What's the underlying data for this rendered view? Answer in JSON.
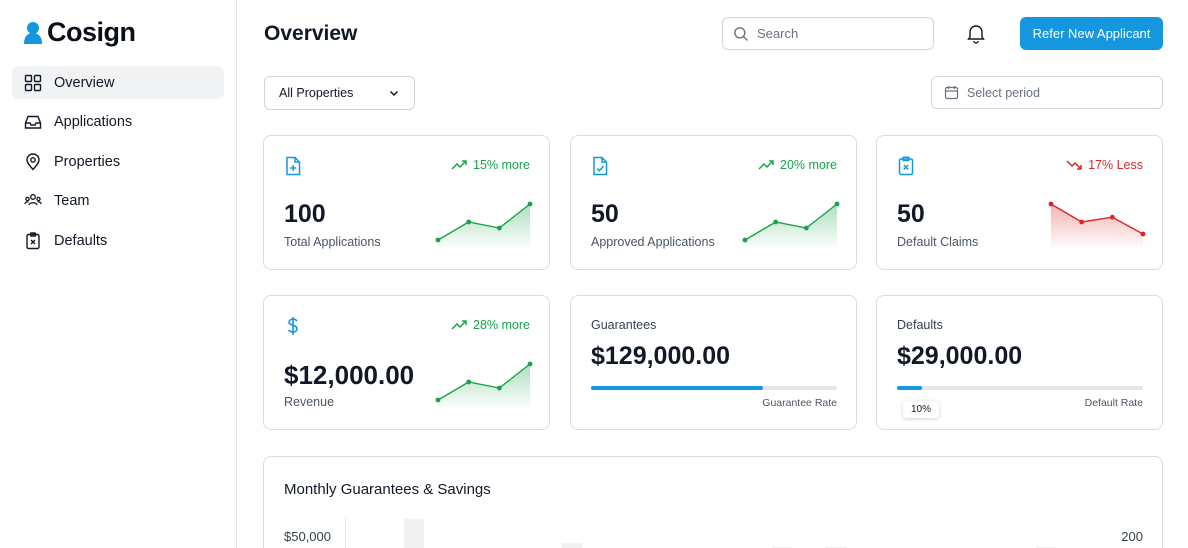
{
  "app": {
    "brand": "Cosign",
    "accent_color": "#1597e0",
    "up_color": "#16a34a",
    "down_color": "#dc2626"
  },
  "sidebar": {
    "items": [
      {
        "label": "Overview",
        "icon": "grid-icon",
        "active": true
      },
      {
        "label": "Applications",
        "icon": "inbox-icon",
        "active": false
      },
      {
        "label": "Properties",
        "icon": "map-pin-icon",
        "active": false
      },
      {
        "label": "Team",
        "icon": "users-icon",
        "active": false
      },
      {
        "label": "Defaults",
        "icon": "clipboard-x-icon",
        "active": false
      }
    ]
  },
  "header": {
    "title": "Overview",
    "search_placeholder": "Search",
    "refer_button": "Refer New Applicant"
  },
  "filters": {
    "property_select": "All Properties",
    "period_placeholder": "Select period"
  },
  "stats": [
    {
      "value": "100",
      "label": "Total Applications",
      "trend": "15% more",
      "direction": "up",
      "icon": "file-plus-icon",
      "spark": [
        10,
        40,
        30,
        70
      ]
    },
    {
      "value": "50",
      "label": "Approved Applications",
      "trend": "20% more",
      "direction": "up",
      "icon": "file-check-icon",
      "spark": [
        10,
        40,
        30,
        70
      ]
    },
    {
      "value": "50",
      "label": "Default Claims",
      "trend": "17% Less",
      "direction": "down",
      "icon": "clipboard-x-icon",
      "spark": [
        70,
        40,
        48,
        20
      ]
    },
    {
      "value": "$12,000.00",
      "label": "Revenue",
      "trend": "28% more",
      "direction": "up",
      "icon": "dollar-icon",
      "spark": [
        10,
        40,
        30,
        70
      ]
    }
  ],
  "guarantees": {
    "label": "Guarantees",
    "amount": "$129,000.00",
    "rate_label": "Guarantee Rate",
    "rate_fraction": 0.7
  },
  "defaults": {
    "label": "Defaults",
    "amount": "$29,000.00",
    "rate_label": "Default Rate",
    "rate_fraction": 0.1,
    "tooltip": "10%"
  },
  "monthly": {
    "title": "Monthly Guarantees & Savings",
    "y_left_top": "$50,000",
    "y_right_top": "200"
  }
}
